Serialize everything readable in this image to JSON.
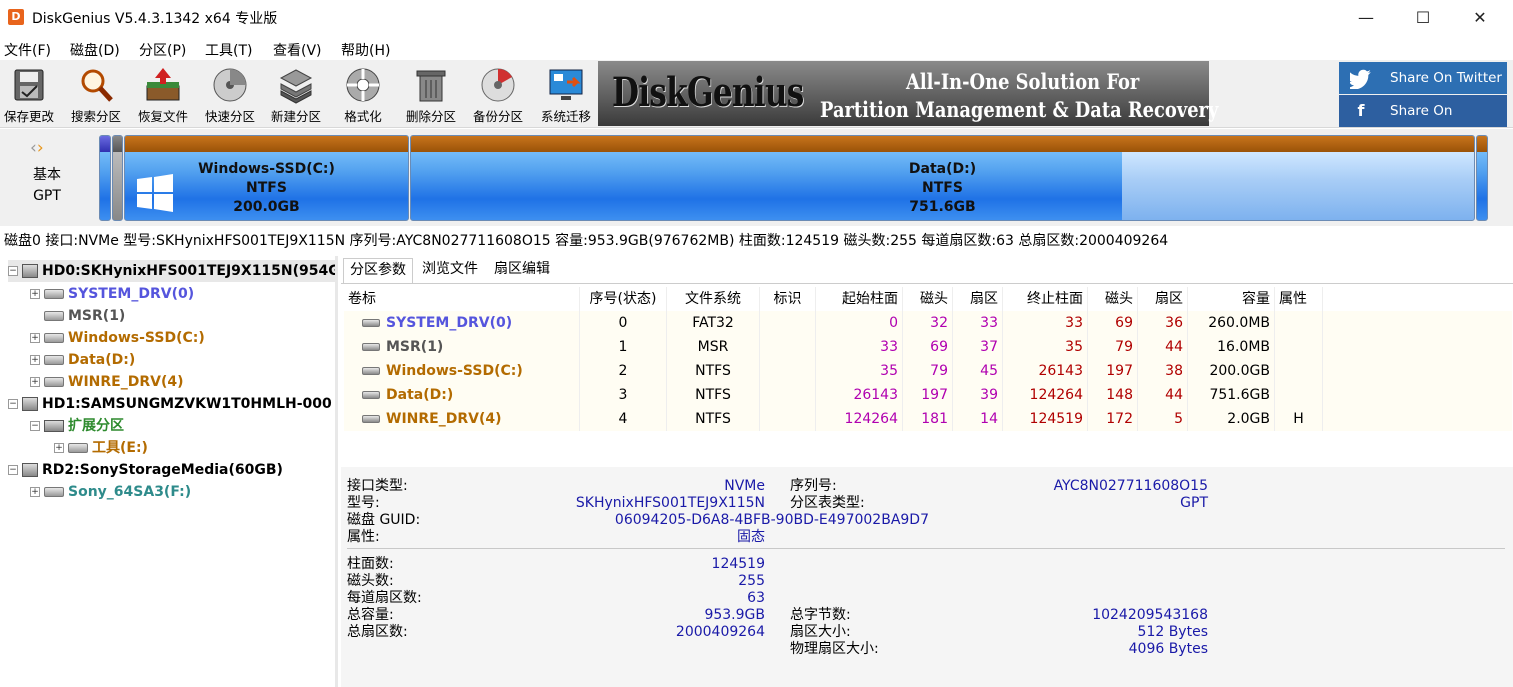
{
  "window": {
    "title": "DiskGenius V5.4.3.1342 x64 专业版",
    "app_icon_letter": "D",
    "controls": {
      "minimize": "—",
      "maximize": "☐",
      "close": "✕"
    }
  },
  "menu": [
    "文件(F)",
    "磁盘(D)",
    "分区(P)",
    "工具(T)",
    "查看(V)",
    "帮助(H)"
  ],
  "toolbar": {
    "buttons": [
      {
        "label": "保存更改",
        "icon": "save-icon"
      },
      {
        "label": "搜索分区",
        "icon": "search-icon"
      },
      {
        "label": "恢复文件",
        "icon": "recover-icon"
      },
      {
        "label": "快速分区",
        "icon": "quick-partition-icon"
      },
      {
        "label": "新建分区",
        "icon": "new-partition-icon"
      },
      {
        "label": "格式化",
        "icon": "format-icon"
      },
      {
        "label": "删除分区",
        "icon": "delete-icon"
      },
      {
        "label": "备份分区",
        "icon": "backup-icon"
      },
      {
        "label": "系统迁移",
        "icon": "migrate-icon"
      }
    ],
    "banner": {
      "logo": "DiskGenius",
      "line1": "All-In-One Solution For",
      "line2": "Partition Management & Data Recovery"
    },
    "social": [
      {
        "label": "Share On Twitter",
        "icon": "twitter-icon",
        "color": "#2d6fb3"
      },
      {
        "label": "Share On Facebook",
        "icon": "facebook-icon",
        "color": "#2d5fa0"
      }
    ]
  },
  "diskmap": {
    "disk_type_line1": "基本",
    "disk_type_line2": "GPT",
    "partitions": [
      {
        "name": "Windows-SSD(C:)",
        "fs": "NTFS",
        "size": "200.0GB"
      },
      {
        "name": "Data(D:)",
        "fs": "NTFS",
        "size": "751.6GB"
      }
    ]
  },
  "disk_info_line": "磁盘0 接口:NVMe  型号:SKHynixHFS001TEJ9X115N  序列号:AYC8N027711608O15  容量:953.9GB(976762MB)  柱面数:124519  磁头数:255  每道扇区数:63  总扇区数:2000409264",
  "tree": [
    {
      "label": "HD0:SKHynixHFS001TEJ9X115N(954G",
      "kind": "disk",
      "color": "#000000",
      "selected": true
    },
    {
      "label": "SYSTEM_DRV(0)",
      "kind": "part",
      "color": "#5555dd"
    },
    {
      "label": "MSR(1)",
      "kind": "part",
      "color": "#555555"
    },
    {
      "label": "Windows-SSD(C:)",
      "kind": "part",
      "color": "#b36b00"
    },
    {
      "label": "Data(D:)",
      "kind": "part",
      "color": "#b36b00"
    },
    {
      "label": "WINRE_DRV(4)",
      "kind": "part",
      "color": "#b36b00"
    },
    {
      "label": "HD1:SAMSUNGMZVKW1T0HMLH-000",
      "kind": "disk",
      "color": "#000000"
    },
    {
      "label": "扩展分区",
      "kind": "ext",
      "color": "#2e8b2e"
    },
    {
      "label": "工具(E:)",
      "kind": "part",
      "color": "#b36b00"
    },
    {
      "label": "RD2:SonyStorageMedia(60GB)",
      "kind": "disk",
      "color": "#000000"
    },
    {
      "label": "Sony_64SA3(F:)",
      "kind": "part",
      "color": "#2e8b8b"
    }
  ],
  "tabs": [
    "分区参数",
    "浏览文件",
    "扇区编辑"
  ],
  "table": {
    "headers": [
      "卷标",
      "序号(状态)",
      "文件系统",
      "标识",
      "起始柱面",
      "磁头",
      "扇区",
      "终止柱面",
      "磁头",
      "扇区",
      "容量",
      "属性"
    ],
    "rows": [
      {
        "name": "SYSTEM_DRV(0)",
        "name_color": "#5555dd",
        "idx": "0",
        "fs": "FAT32",
        "flag": "",
        "sc": "0",
        "sh": "32",
        "ss": "33",
        "ec": "33",
        "eh": "69",
        "es": "36",
        "cap": "260.0MB",
        "attr": ""
      },
      {
        "name": "MSR(1)",
        "name_color": "#555555",
        "idx": "1",
        "fs": "MSR",
        "flag": "",
        "sc": "33",
        "sh": "69",
        "ss": "37",
        "ec": "35",
        "eh": "79",
        "es": "44",
        "cap": "16.0MB",
        "attr": ""
      },
      {
        "name": "Windows-SSD(C:)",
        "name_color": "#b36b00",
        "idx": "2",
        "fs": "NTFS",
        "flag": "",
        "sc": "35",
        "sh": "79",
        "ss": "45",
        "ec": "26143",
        "eh": "197",
        "es": "38",
        "cap": "200.0GB",
        "attr": ""
      },
      {
        "name": "Data(D:)",
        "name_color": "#b36b00",
        "idx": "3",
        "fs": "NTFS",
        "flag": "",
        "sc": "26143",
        "sh": "197",
        "ss": "39",
        "ec": "124264",
        "eh": "148",
        "es": "44",
        "cap": "751.6GB",
        "attr": ""
      },
      {
        "name": "WINRE_DRV(4)",
        "name_color": "#b36b00",
        "idx": "4",
        "fs": "NTFS",
        "flag": "",
        "sc": "124264",
        "sh": "181",
        "ss": "14",
        "ec": "124519",
        "eh": "172",
        "es": "5",
        "cap": "2.0GB",
        "attr": "H"
      }
    ],
    "colors": {
      "start": "#b000b0",
      "end": "#b00000"
    }
  },
  "details": {
    "interface_label": "接口类型:",
    "interface_value": "NVMe",
    "serial_label": "序列号:",
    "serial_value": "AYC8N027711608O15",
    "model_label": "型号:",
    "model_value": "SKHynixHFS001TEJ9X115N",
    "ptable_label": "分区表类型:",
    "ptable_value": "GPT",
    "guid_label": "磁盘 GUID:",
    "guid_value": "06094205-D6A8-4BFB-90BD-E497002BA9D7",
    "attr_label": "属性:",
    "attr_value": "固态",
    "cyl_label": "柱面数:",
    "cyl_value": "124519",
    "heads_label": "磁头数:",
    "heads_value": "255",
    "spt_label": "每道扇区数:",
    "spt_value": "63",
    "cap_label": "总容量:",
    "cap_value": "953.9GB",
    "bytes_label": "总字节数:",
    "bytes_value": "1024209543168",
    "sectors_label": "总扇区数:",
    "sectors_value": "2000409264",
    "secsize_label": "扇区大小:",
    "secsize_value": "512 Bytes",
    "physsec_label": "物理扇区大小:",
    "physsec_value": "4096 Bytes"
  }
}
